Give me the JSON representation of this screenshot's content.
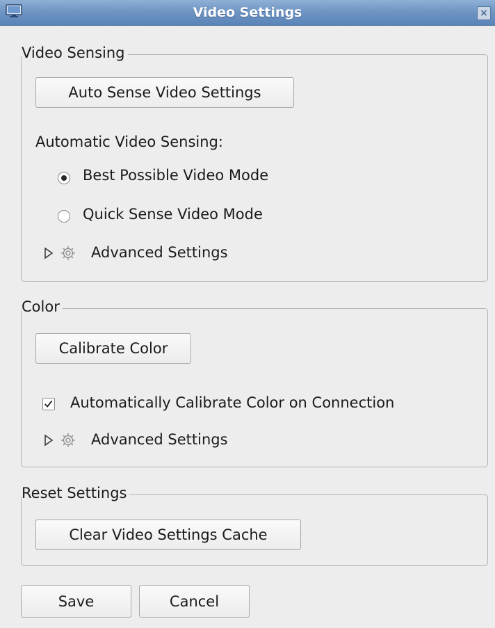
{
  "window": {
    "title": "Video Settings",
    "close_glyph": "×"
  },
  "video_sensing": {
    "legend": "Video Sensing",
    "auto_sense_button": "Auto Sense Video Settings",
    "auto_label": "Automatic Video Sensing:",
    "options": [
      {
        "label": "Best Possible Video Mode",
        "checked": true
      },
      {
        "label": "Quick Sense Video Mode",
        "checked": false
      }
    ],
    "advanced_label": "Advanced Settings"
  },
  "color": {
    "legend": "Color",
    "calibrate_button": "Calibrate Color",
    "auto_calibrate_label": "Automatically Calibrate Color on Connection",
    "auto_calibrate_checked": true,
    "advanced_label": "Advanced Settings"
  },
  "reset": {
    "legend": "Reset Settings",
    "clear_button": "Clear Video Settings Cache"
  },
  "footer": {
    "save_label": "Save",
    "cancel_label": "Cancel"
  },
  "icons": {
    "app": "monitor-icon",
    "close": "close-icon",
    "expander": "triangle-right-icon",
    "gear": "gear-icon"
  }
}
